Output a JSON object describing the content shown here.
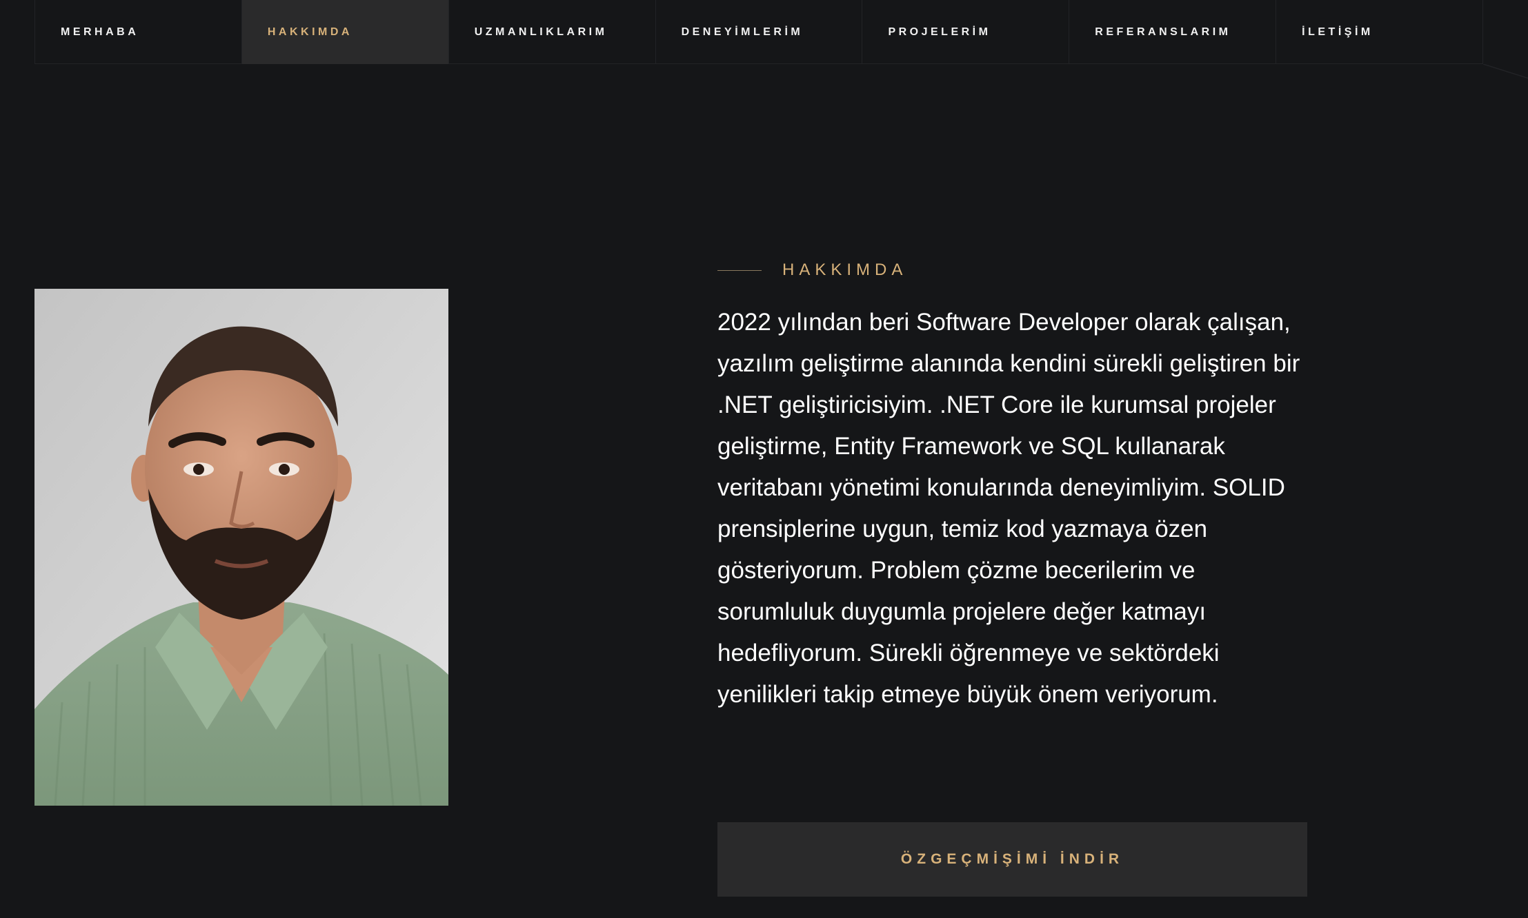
{
  "nav": {
    "items": [
      {
        "label": "MERHABA",
        "active": false
      },
      {
        "label": "HAKKIMDA",
        "active": true
      },
      {
        "label": "UZMANLIKLARIM",
        "active": false
      },
      {
        "label": "DENEYİMLERİM",
        "active": false
      },
      {
        "label": "PROJELERİM",
        "active": false
      },
      {
        "label": "REFERANSLARIM",
        "active": false
      },
      {
        "label": "İLETİŞİM",
        "active": false
      }
    ]
  },
  "about": {
    "section_title": "HAKKIMDA",
    "text": "2022 yılından beri Software Developer olarak çalışan, yazılım geliştirme alanında kendini sürekli geliştiren bir .NET geliştiricisiyim. .NET Core ile kurumsal projeler geliştirme, Entity Framework ve SQL kullanarak veritabanı yönetimi konularında deneyimliyim. SOLID prensiplerine uygun, temiz kod yazmaya özen gösteriyorum. Problem çözme becerilerim ve sorumluluk duygumla projelere değer katmayı hedefliyorum. Sürekli öğrenmeye ve sektördeki yenilikleri takip etmeye büyük önem veriyorum.",
    "cv_button_label": "ÖZGEÇMİŞİMİ İNDİR"
  },
  "colors": {
    "background": "#151618",
    "accent": "#d8b27a",
    "active_nav_bg": "#2a2a2b",
    "text": "#ffffff"
  }
}
